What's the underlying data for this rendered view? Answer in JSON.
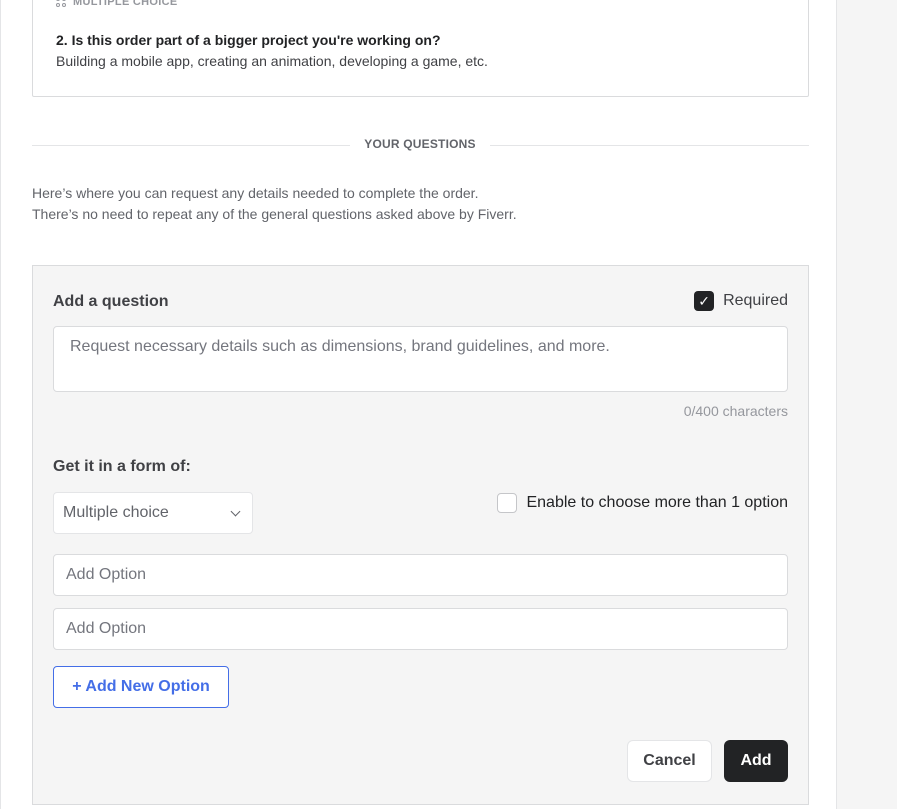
{
  "previous_question": {
    "type_label": "Multiple choice",
    "title": "2. Is this order part of a bigger project you're working on?",
    "description": "Building a mobile app, creating an animation, developing a game, etc."
  },
  "section": {
    "title": "YOUR QUESTIONS",
    "intro_line_1": "Here’s where you can request any details needed to complete the order.",
    "intro_line_2": "There’s no need to repeat any of the general questions asked above by Fiverr."
  },
  "editor": {
    "heading": "Add a question",
    "required_label": "Required",
    "required_checked": true,
    "question_placeholder": "Request necessary details such as dimensions, brand guidelines, and more.",
    "question_value": "",
    "char_count": "0/400 characters",
    "form_label": "Get it in a form of:",
    "form_selected": "Multiple choice",
    "multi_select_label": "Enable to choose more than 1 option",
    "multi_select_checked": false,
    "options": [
      {
        "placeholder": "Add Option",
        "value": ""
      },
      {
        "placeholder": "Add Option",
        "value": ""
      }
    ],
    "add_option_label": "+ Add New Option",
    "cancel_label": "Cancel",
    "add_label": "Add"
  },
  "colors": {
    "primary_dark": "#222325",
    "link_blue": "#446ee7",
    "panel_bg": "#f5f5f5"
  }
}
